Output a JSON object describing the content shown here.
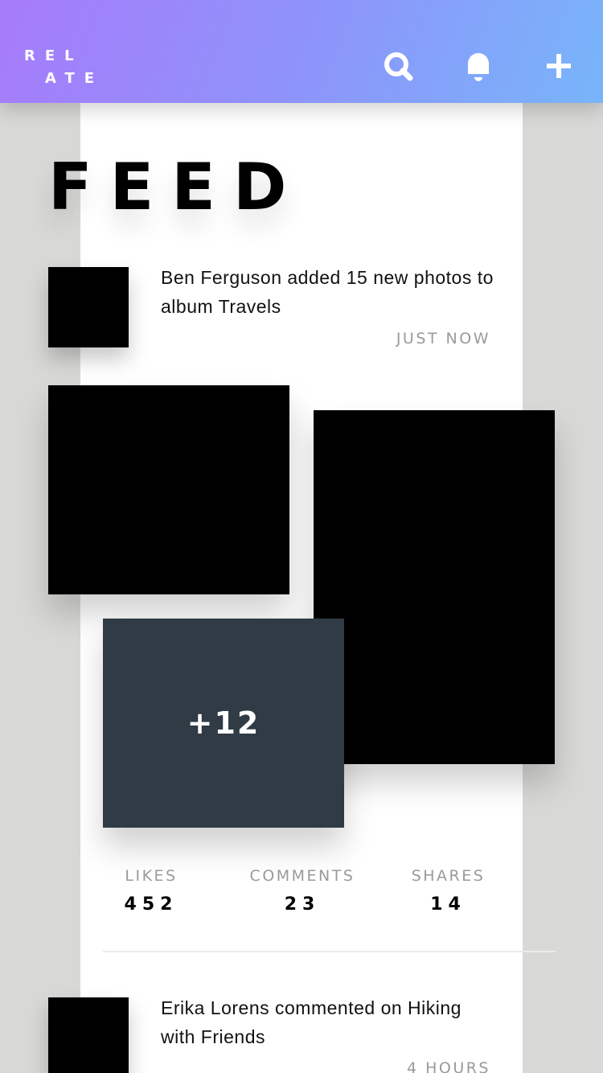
{
  "app": {
    "logo_line1": "REL",
    "logo_line2": "ATE"
  },
  "header": {
    "icons": [
      "search-icon",
      "bell-icon",
      "plus-icon"
    ],
    "gradient": [
      "#a77bfb",
      "#78b5fa"
    ]
  },
  "page": {
    "title": "FEED"
  },
  "posts": [
    {
      "text": "Ben Ferguson added 15 new photos to album Travels",
      "time": "JUST NOW",
      "more_photos": "+12",
      "stats": {
        "likes_label": "LIKES",
        "likes_value": "452",
        "comments_label": "COMMENTS",
        "comments_value": "23",
        "shares_label": "SHARES",
        "shares_value": "14"
      }
    },
    {
      "text": "Erika Lorens commented on Hiking with Friends",
      "time": "4 HOURS"
    }
  ],
  "colors": {
    "background": "#d8d8d6",
    "card": "#ffffff",
    "tile": "#303b45",
    "muted_text": "#9a9a9a"
  }
}
